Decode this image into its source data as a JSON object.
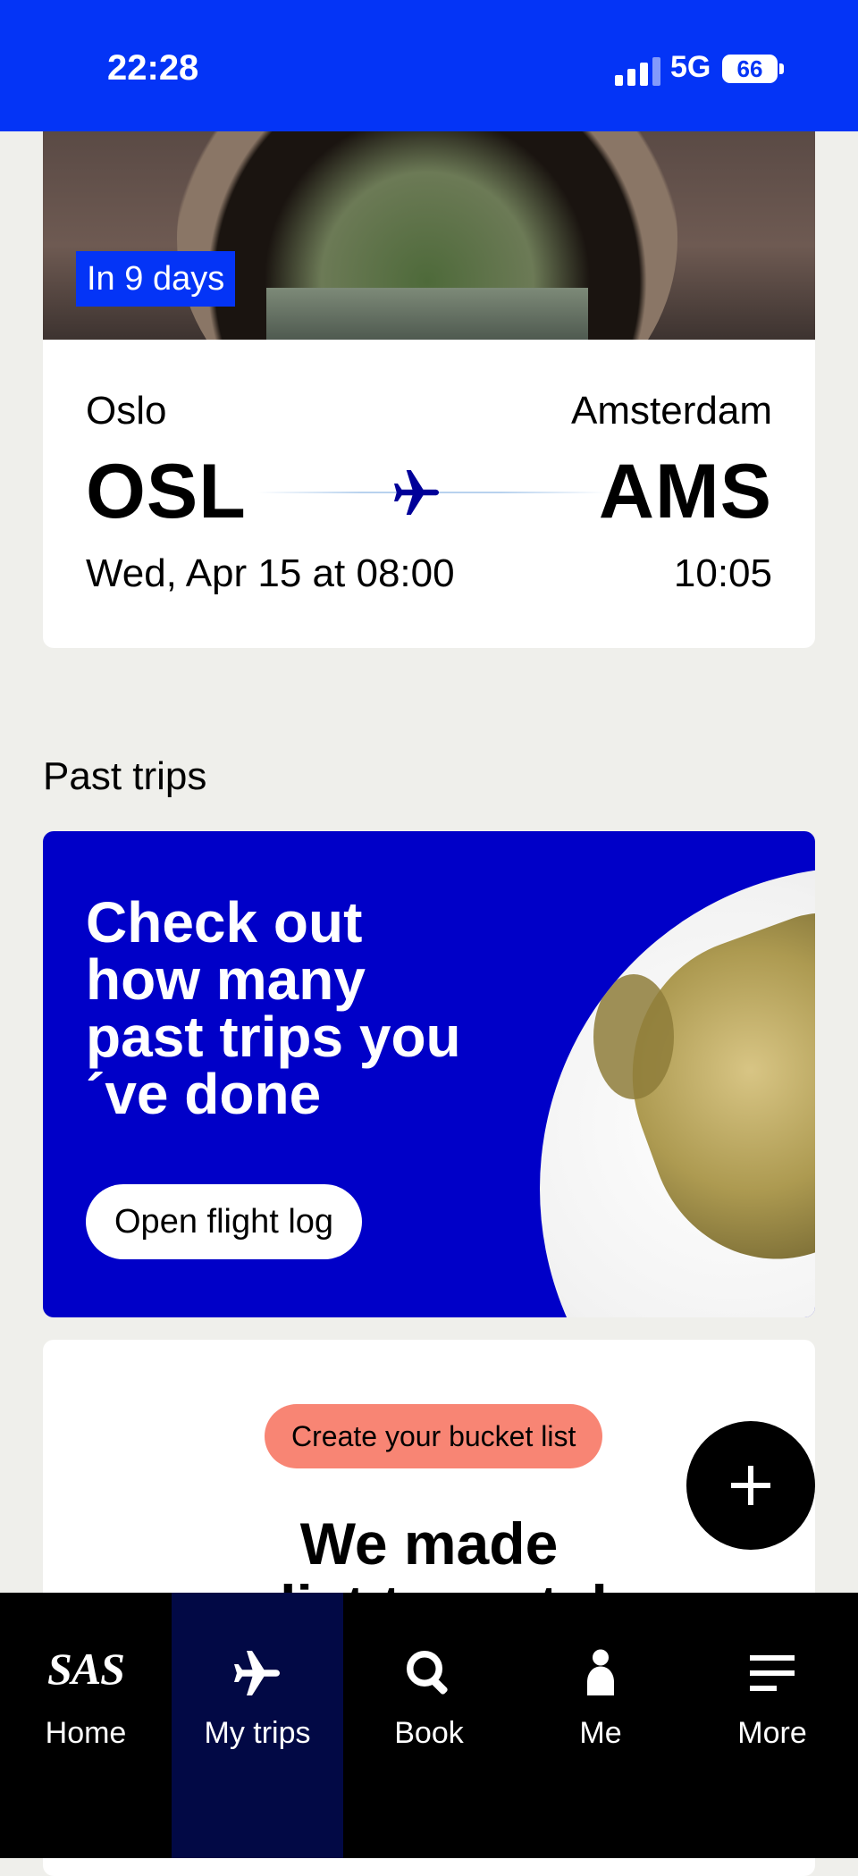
{
  "status_bar": {
    "time": "22:28",
    "network": "5G",
    "battery": "66"
  },
  "upcoming_trip": {
    "badge": "In 9 days",
    "from_city": "Oslo",
    "to_city": "Amsterdam",
    "from_code": "OSL",
    "to_code": "AMS",
    "departure": "Wed, Apr 15 at 08:00",
    "arrival": "10:05"
  },
  "past_trips": {
    "section_title": "Past trips",
    "promo_title": "Check out how many past trips you ´ve done",
    "button_label": "Open flight log"
  },
  "bucket_list": {
    "pill_label": "Create your bucket list",
    "title": "We made",
    "subtitle": "a list to match"
  },
  "fab": {
    "icon": "plus-icon"
  },
  "tab_bar": {
    "items": [
      {
        "label": "Home",
        "logo": "SAS",
        "icon": "sas-logo-icon"
      },
      {
        "label": "My trips",
        "icon": "airplane-icon",
        "active": true
      },
      {
        "label": "Book",
        "icon": "search-icon"
      },
      {
        "label": "Me",
        "icon": "person-icon"
      },
      {
        "label": "More",
        "icon": "menu-icon"
      }
    ]
  },
  "colors": {
    "brand_blue": "#0434f6",
    "promo_blue": "#0000c8",
    "pill": "#f88574",
    "tab_active": "#020945"
  }
}
